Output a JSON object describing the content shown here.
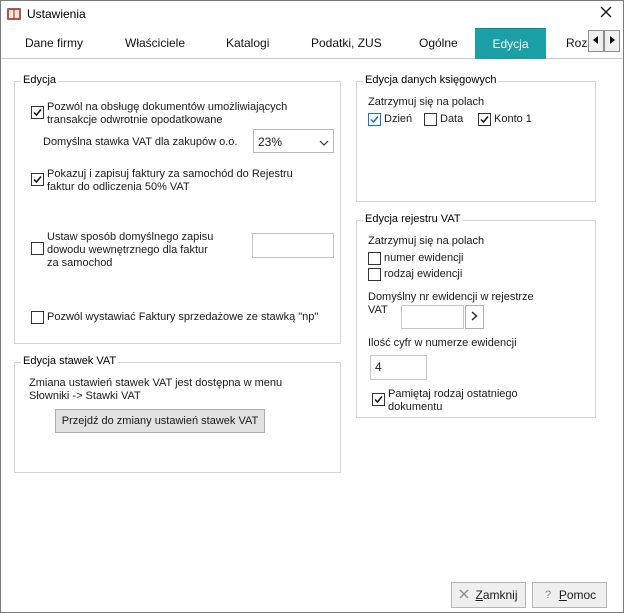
{
  "window": {
    "title": "Ustawienia",
    "close_icon": "close-icon",
    "app_icon": "book-icon"
  },
  "tabs": [
    {
      "label": "Dane firmy"
    },
    {
      "label": "Właściciele"
    },
    {
      "label": "Katalogi"
    },
    {
      "label": "Podatki, ZUS"
    },
    {
      "label": "Ogólne"
    },
    {
      "label": "Edycja",
      "active": true
    },
    {
      "label": "Roz"
    }
  ],
  "tab_scroll": {
    "left_icon": "arrow-left-icon",
    "right_icon": "arrow-right-icon"
  },
  "edycja": {
    "legend": "Edycja",
    "reverse_charge_line1": "Pozwól na obsługę dokumentów umożliwiających",
    "reverse_charge_line2": "transakcje odwrotnie opodatkowane",
    "reverse_charge_checked": true,
    "vat_rate_label": "Domyślna stawka VAT dla zakupów o.o.",
    "vat_rate_value": "23%",
    "car_register_line1": "Pokazuj i zapisuj faktury za samochód do Rejestru",
    "car_register_line2": "faktur  do odliczenia 50% VAT",
    "car_register_checked": true,
    "internal_doc_line1": "Ustaw sposób domyślnego zapisu",
    "internal_doc_line2": "dowodu wewnętrznego dla faktur",
    "internal_doc_line3": "za samochod",
    "internal_doc_checked": false,
    "internal_doc_value": "",
    "np_invoice_label": "Pozwól wystawiać Faktury sprzedażowe  ze stawką \"np\"",
    "np_invoice_checked": false
  },
  "stawki_vat": {
    "legend": "Edycja stawek VAT",
    "info_line1": "Zmiana ustawień stawek VAT jest dostępna  w menu",
    "info_line2": "Słowniki -> Stawki VAT",
    "button_label": "Przejdź do zmiany ustawień stawek VAT"
  },
  "ksiegowe": {
    "legend": "Edycja danych księgowych",
    "stop_label": "Zatrzymuj się na polach",
    "fields": [
      {
        "label": "Dzień",
        "checked": true
      },
      {
        "label": "Data",
        "checked": false
      },
      {
        "label": "Konto 1",
        "checked": true
      }
    ]
  },
  "rejestr_vat": {
    "legend": "Edycja rejestru VAT",
    "stop_label": "Zatrzymuj się na polach",
    "fields": [
      {
        "label": "numer ewidencji",
        "checked": false
      },
      {
        "label": "rodzaj ewidencji",
        "checked": false
      }
    ],
    "default_nr_line1": "Domyślny nr ewidencji w rejestrze",
    "default_nr_line2": "VAT",
    "default_nr_value": "",
    "default_nr_button_icon": "chevron-right-icon",
    "digits_label": "Ilość cyfr w numerze ewidencji",
    "digits_value": "4",
    "remember_line1": "Pamiętaj rodzaj ostatniego",
    "remember_line2": "dokumentu",
    "remember_checked": true
  },
  "footer": {
    "close_prefix": "Z",
    "close_rest": "amknij",
    "close_icon": "x-icon",
    "help_prefix": "P",
    "help_rest": "omoc",
    "help_icon": "question-icon"
  }
}
